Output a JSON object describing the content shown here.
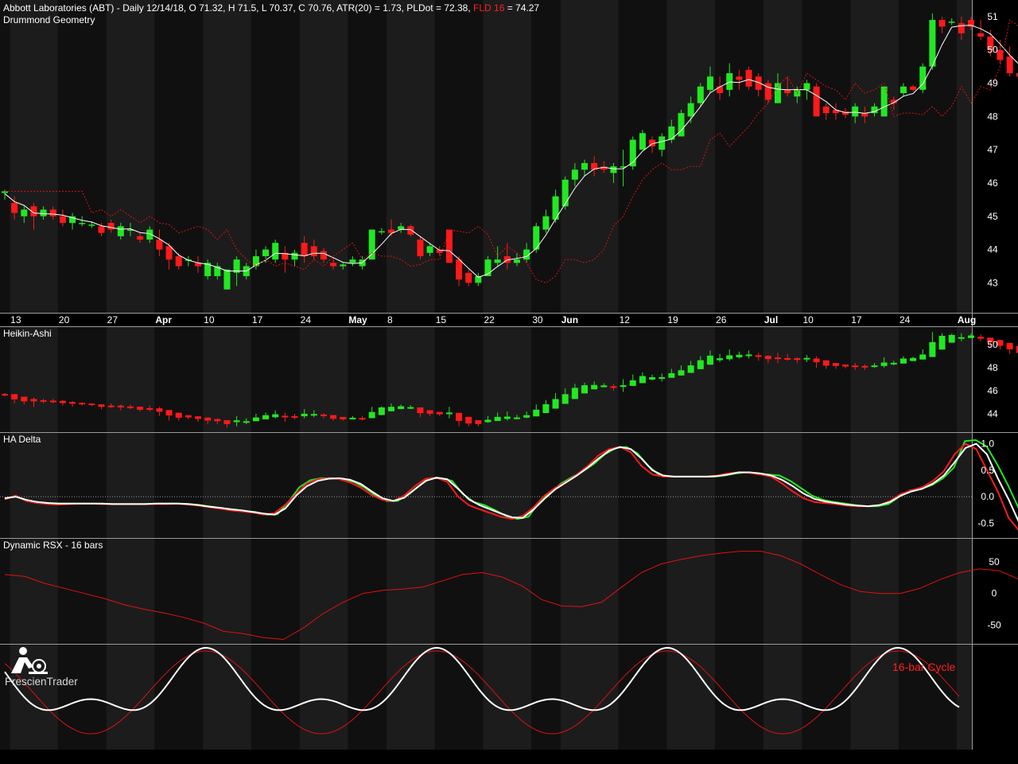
{
  "header": {
    "title_main": "Abbott Laboratories (ABT) - Daily 12/14/18, O 71.32, H 71.5, L 70.37, C 70.76, ATR(20) = 1.73, PLDot = 72.38, ",
    "title_fld": "FLD 16",
    "title_end": " = 74.27",
    "subtitle": "Drummond Geometry"
  },
  "panels": {
    "heikin_ashi": "Heikin-Ashi",
    "ha_delta": "HA Delta",
    "rsx": "Dynamic RSX - 16 bars",
    "cycle_label": "16-bar Cycle"
  },
  "logo": {
    "text": "PrescienTrader",
    "icon": "trader-at-desk-icon"
  },
  "colors": {
    "background": "#000000",
    "band_light": "#1c1c1c",
    "band_dark": "#101010",
    "up": "#22e822",
    "down": "#ff1a1a",
    "white": "#ffffff",
    "grid": "#8a8a8a"
  },
  "date_axis": [
    {
      "label": "13",
      "bar": 1
    },
    {
      "label": "20",
      "bar": 6
    },
    {
      "label": "27",
      "bar": 11
    },
    {
      "label": "Apr",
      "bar": 16
    },
    {
      "label": "10",
      "bar": 21
    },
    {
      "label": "17",
      "bar": 26
    },
    {
      "label": "24",
      "bar": 31
    },
    {
      "label": "May",
      "bar": 36
    },
    {
      "label": "8",
      "bar": 40
    },
    {
      "label": "15",
      "bar": 45
    },
    {
      "label": "22",
      "bar": 50
    },
    {
      "label": "30",
      "bar": 55
    },
    {
      "label": "Jun",
      "bar": 58
    },
    {
      "label": "12",
      "bar": 64
    },
    {
      "label": "19",
      "bar": 69
    },
    {
      "label": "26",
      "bar": 74
    },
    {
      "label": "Jul",
      "bar": 79
    },
    {
      "label": "10",
      "bar": 83
    },
    {
      "label": "17",
      "bar": 88
    },
    {
      "label": "24",
      "bar": 93
    },
    {
      "label": "Aug",
      "bar": 99
    }
  ],
  "chart_data": [
    {
      "type": "candlestick",
      "title": "Drummond Geometry",
      "ylim": [
        42.1,
        51.5
      ],
      "yticks": [
        43,
        44,
        45,
        46,
        47,
        48,
        49,
        50,
        51
      ],
      "candles": [
        [
          45.7,
          45.8,
          45.5,
          45.75
        ],
        [
          45.4,
          45.6,
          44.9,
          45.1
        ],
        [
          45.0,
          45.3,
          44.8,
          45.2
        ],
        [
          45.3,
          45.4,
          44.6,
          45.0
        ],
        [
          45.0,
          45.3,
          44.9,
          45.2
        ],
        [
          45.2,
          45.3,
          44.9,
          45.0
        ],
        [
          45.0,
          45.2,
          44.7,
          44.8
        ],
        [
          44.8,
          45.1,
          44.6,
          45.0
        ],
        [
          44.8,
          45.0,
          44.7,
          44.8
        ],
        [
          44.75,
          44.85,
          44.65,
          44.75
        ],
        [
          44.7,
          44.8,
          44.4,
          44.5
        ],
        [
          44.8,
          44.9,
          44.5,
          44.6
        ],
        [
          44.4,
          44.8,
          44.3,
          44.7
        ],
        [
          44.6,
          44.8,
          44.4,
          44.6
        ],
        [
          44.4,
          44.5,
          44.2,
          44.3
        ],
        [
          44.3,
          44.7,
          44.2,
          44.6
        ],
        [
          44.3,
          44.6,
          43.8,
          44.0
        ],
        [
          44.1,
          44.2,
          43.4,
          43.7
        ],
        [
          43.8,
          43.9,
          43.4,
          43.5
        ],
        [
          43.7,
          43.8,
          43.5,
          43.7
        ],
        [
          43.6,
          43.8,
          43.3,
          43.5
        ],
        [
          43.2,
          43.7,
          43.1,
          43.6
        ],
        [
          43.2,
          43.6,
          43.1,
          43.5
        ],
        [
          42.8,
          43.4,
          42.8,
          43.4
        ],
        [
          43.3,
          43.8,
          42.9,
          43.7
        ],
        [
          43.2,
          43.6,
          43.1,
          43.5
        ],
        [
          43.5,
          44.0,
          43.4,
          43.8
        ],
        [
          43.8,
          44.1,
          43.6,
          44.0
        ],
        [
          43.7,
          44.3,
          43.6,
          44.2
        ],
        [
          43.9,
          44.1,
          43.3,
          43.7
        ],
        [
          43.7,
          44.0,
          43.5,
          43.9
        ],
        [
          44.2,
          44.4,
          43.6,
          43.8
        ],
        [
          44.1,
          44.3,
          43.7,
          43.8
        ],
        [
          43.95,
          44.05,
          43.6,
          43.7
        ],
        [
          43.6,
          43.75,
          43.4,
          43.5
        ],
        [
          43.5,
          43.6,
          43.4,
          43.55
        ],
        [
          43.6,
          43.8,
          43.5,
          43.7
        ],
        [
          43.5,
          43.8,
          43.4,
          43.7
        ],
        [
          43.7,
          44.6,
          43.7,
          44.6
        ],
        [
          44.55,
          44.65,
          44.45,
          44.55
        ],
        [
          44.6,
          44.9,
          44.4,
          44.5
        ],
        [
          44.6,
          44.8,
          44.5,
          44.7
        ],
        [
          44.7,
          44.75,
          44.4,
          44.45
        ],
        [
          44.3,
          44.4,
          43.7,
          43.8
        ],
        [
          43.9,
          44.2,
          43.8,
          44.1
        ],
        [
          44.0,
          44.1,
          43.8,
          43.9
        ],
        [
          44.6,
          44.6,
          43.6,
          43.6
        ],
        [
          43.7,
          43.8,
          42.9,
          43.1
        ],
        [
          43.3,
          43.4,
          42.9,
          43.0
        ],
        [
          43.0,
          43.3,
          42.9,
          43.2
        ],
        [
          43.2,
          43.8,
          43.2,
          43.7
        ],
        [
          43.6,
          44.1,
          43.5,
          43.7
        ],
        [
          43.8,
          44.2,
          43.4,
          43.6
        ],
        [
          43.6,
          43.9,
          43.5,
          43.7
        ],
        [
          43.7,
          44.2,
          43.6,
          44.0
        ],
        [
          44.0,
          44.8,
          43.9,
          44.7
        ],
        [
          44.6,
          45.2,
          44.5,
          45.0
        ],
        [
          44.9,
          45.8,
          44.8,
          45.6
        ],
        [
          45.3,
          46.2,
          45.2,
          46.1
        ],
        [
          46.1,
          46.6,
          45.9,
          46.4
        ],
        [
          46.4,
          46.7,
          46.2,
          46.6
        ],
        [
          46.6,
          46.8,
          46.2,
          46.4
        ],
        [
          46.5,
          46.65,
          46.3,
          46.4
        ],
        [
          46.3,
          46.6,
          46.0,
          46.5
        ],
        [
          46.5,
          47.0,
          45.9,
          46.5
        ],
        [
          46.5,
          47.4,
          46.4,
          47.3
        ],
        [
          47.0,
          47.6,
          47.0,
          47.5
        ],
        [
          47.3,
          47.4,
          46.9,
          47.1
        ],
        [
          47.0,
          47.5,
          46.8,
          47.4
        ],
        [
          47.3,
          47.9,
          47.2,
          47.7
        ],
        [
          47.4,
          48.2,
          47.4,
          48.1
        ],
        [
          48.0,
          48.6,
          47.8,
          48.4
        ],
        [
          48.4,
          49.0,
          48.3,
          48.9
        ],
        [
          48.8,
          49.5,
          48.7,
          49.2
        ],
        [
          48.9,
          49.2,
          48.5,
          48.7
        ],
        [
          48.8,
          49.6,
          48.6,
          49.3
        ],
        [
          49.2,
          49.4,
          48.8,
          49.1
        ],
        [
          49.4,
          49.5,
          48.8,
          48.9
        ],
        [
          49.2,
          49.3,
          48.6,
          48.8
        ],
        [
          49.0,
          49.1,
          48.4,
          48.5
        ],
        [
          48.4,
          49.3,
          48.4,
          49.0
        ],
        [
          48.8,
          49.2,
          48.6,
          48.7
        ],
        [
          48.6,
          48.9,
          48.4,
          48.8
        ],
        [
          48.8,
          49.1,
          48.5,
          49.0
        ],
        [
          48.9,
          49.0,
          48.0,
          48.0
        ],
        [
          48.3,
          48.4,
          47.9,
          48.1
        ],
        [
          48.2,
          48.4,
          47.9,
          48.1
        ],
        [
          48.15,
          48.25,
          47.95,
          48.05
        ],
        [
          48.0,
          48.4,
          47.8,
          48.3
        ],
        [
          48.1,
          48.3,
          47.8,
          48.0
        ],
        [
          48.1,
          48.4,
          48.0,
          48.3
        ],
        [
          48.0,
          48.9,
          48.0,
          48.9
        ],
        [
          48.5,
          48.6,
          48.2,
          48.4
        ],
        [
          48.7,
          49.0,
          48.6,
          48.9
        ],
        [
          48.9,
          48.95,
          48.75,
          48.8
        ],
        [
          48.8,
          49.6,
          48.7,
          49.5
        ],
        [
          49.5,
          51.1,
          49.4,
          50.9
        ],
        [
          50.9,
          51.0,
          50.5,
          50.7
        ],
        [
          50.85,
          50.95,
          50.75,
          50.85
        ],
        [
          50.8,
          51.0,
          50.3,
          50.5
        ],
        [
          50.9,
          51.0,
          50.6,
          50.7
        ],
        [
          50.5,
          50.9,
          50.3,
          50.4
        ],
        [
          50.4,
          50.6,
          49.8,
          50.0
        ],
        [
          50.0,
          50.3,
          49.6,
          49.7
        ],
        [
          49.8,
          50.1,
          49.2,
          49.3
        ],
        [
          49.3,
          49.6,
          49.0,
          49.2
        ]
      ],
      "overlays": [
        {
          "name": "PLDot",
          "style": "white-solid"
        },
        {
          "name": "FLD 16",
          "style": "red-dotted"
        }
      ]
    },
    {
      "type": "heikin-ashi",
      "title": "Heikin-Ashi",
      "ylim": [
        42.4,
        51.6
      ],
      "yticks": [
        44,
        46,
        48,
        50
      ]
    },
    {
      "type": "line",
      "title": "HA Delta",
      "ylim": [
        -0.78,
        1.22
      ],
      "yticks": [
        -0.5,
        0.0,
        0.5,
        1.0
      ],
      "series": [
        {
          "color": "green",
          "values": [
            -0.05,
            0.02,
            -0.08,
            -0.1,
            -0.12,
            -0.13,
            -0.13,
            -0.13,
            -0.13,
            -0.14,
            -0.14,
            -0.14,
            -0.14,
            -0.14,
            -0.13,
            -0.13,
            -0.13,
            -0.14,
            -0.16,
            -0.19,
            -0.22,
            -0.24,
            -0.27,
            -0.29,
            -0.34,
            -0.33,
            -0.1,
            0.18,
            0.31,
            0.35,
            0.35,
            0.34,
            0.28,
            0.17,
            0.02,
            -0.08,
            -0.08,
            0.05,
            0.21,
            0.35,
            0.35,
            0.3,
            0.05,
            -0.1,
            -0.16,
            -0.26,
            -0.37,
            -0.42,
            -0.38,
            -0.1,
            0.08,
            0.25,
            0.37,
            0.48,
            0.62,
            0.8,
            0.92,
            0.94,
            0.82,
            0.58,
            0.41,
            0.38,
            0.38,
            0.38,
            0.38,
            0.38,
            0.4,
            0.44,
            0.46,
            0.44,
            0.42,
            0.4,
            0.3,
            0.16,
            0.02,
            -0.06,
            -0.1,
            -0.13,
            -0.16,
            -0.18,
            -0.18,
            -0.14,
            0.0,
            0.12,
            0.15,
            0.22,
            0.35,
            0.55,
            1.05,
            1.07,
            0.95,
            0.6,
            0.2,
            -0.25
          ]
        },
        {
          "color": "red",
          "values": [
            -0.05,
            0.02,
            -0.08,
            -0.12,
            -0.14,
            -0.15,
            -0.14,
            -0.13,
            -0.13,
            -0.14,
            -0.14,
            -0.14,
            -0.14,
            -0.14,
            -0.14,
            -0.14,
            -0.13,
            -0.15,
            -0.17,
            -0.2,
            -0.23,
            -0.26,
            -0.28,
            -0.3,
            -0.34,
            -0.31,
            -0.15,
            0.05,
            0.25,
            0.33,
            0.35,
            0.33,
            0.27,
            0.17,
            0.03,
            -0.06,
            -0.08,
            0.02,
            0.2,
            0.34,
            0.36,
            0.28,
            0.0,
            -0.16,
            -0.24,
            -0.31,
            -0.38,
            -0.42,
            -0.36,
            -0.2,
            0.02,
            0.17,
            0.28,
            0.42,
            0.58,
            0.78,
            0.9,
            0.94,
            0.84,
            0.58,
            0.42,
            0.38,
            0.38,
            0.38,
            0.38,
            0.38,
            0.4,
            0.44,
            0.46,
            0.45,
            0.42,
            0.38,
            0.25,
            0.1,
            -0.03,
            -0.1,
            -0.12,
            -0.14,
            -0.17,
            -0.18,
            -0.18,
            -0.16,
            -0.08,
            0.05,
            0.12,
            0.18,
            0.3,
            0.48,
            0.8,
            1.0,
            0.9,
            0.5,
            0.1,
            -0.4,
            -0.65
          ]
        },
        {
          "color": "white",
          "values": [
            -0.03,
            0.0,
            -0.06,
            -0.1,
            -0.12,
            -0.13,
            -0.13,
            -0.13,
            -0.13,
            -0.13,
            -0.14,
            -0.14,
            -0.14,
            -0.14,
            -0.13,
            -0.13,
            -0.13,
            -0.14,
            -0.16,
            -0.19,
            -0.21,
            -0.24,
            -0.26,
            -0.29,
            -0.32,
            -0.34,
            -0.22,
            0.02,
            0.2,
            0.3,
            0.34,
            0.35,
            0.32,
            0.24,
            0.1,
            -0.03,
            -0.08,
            -0.02,
            0.14,
            0.3,
            0.36,
            0.33,
            0.15,
            -0.05,
            -0.16,
            -0.24,
            -0.32,
            -0.39,
            -0.4,
            -0.24,
            -0.04,
            0.14,
            0.27,
            0.4,
            0.55,
            0.72,
            0.87,
            0.94,
            0.9,
            0.72,
            0.5,
            0.4,
            0.38,
            0.38,
            0.38,
            0.38,
            0.39,
            0.42,
            0.46,
            0.46,
            0.44,
            0.4,
            0.32,
            0.2,
            0.06,
            -0.04,
            -0.09,
            -0.12,
            -0.15,
            -0.17,
            -0.18,
            -0.16,
            -0.1,
            0.02,
            0.1,
            0.15,
            0.25,
            0.4,
            0.65,
            0.92,
            1.0,
            0.8,
            0.35,
            -0.05,
            -0.5
          ]
        }
      ]
    },
    {
      "type": "line",
      "title": "Dynamic RSX - 16 bars",
      "ylim": [
        -80,
        88
      ],
      "yticks": [
        -50,
        0,
        50
      ],
      "series": [
        {
          "name": "Dynamic RSX",
          "color": "red",
          "values": [
            30,
            27,
            16,
            8,
            0,
            -8,
            -18,
            -25,
            -31,
            -38,
            -47,
            -60,
            -64,
            -70,
            -73,
            -55,
            -32,
            -14,
            0,
            5,
            7,
            10,
            20,
            30,
            33,
            26,
            12,
            -10,
            -20,
            -21,
            -14,
            10,
            33,
            47,
            54,
            60,
            64,
            67,
            67,
            60,
            47,
            30,
            14,
            3,
            0,
            0,
            8,
            22,
            33,
            39,
            36,
            22
          ]
        }
      ]
    },
    {
      "type": "line",
      "title": "16-bar Cycle",
      "series": [
        {
          "color": "red",
          "kind": "cycle-sine"
        },
        {
          "color": "white",
          "kind": "smoothed-cycle"
        }
      ]
    }
  ]
}
